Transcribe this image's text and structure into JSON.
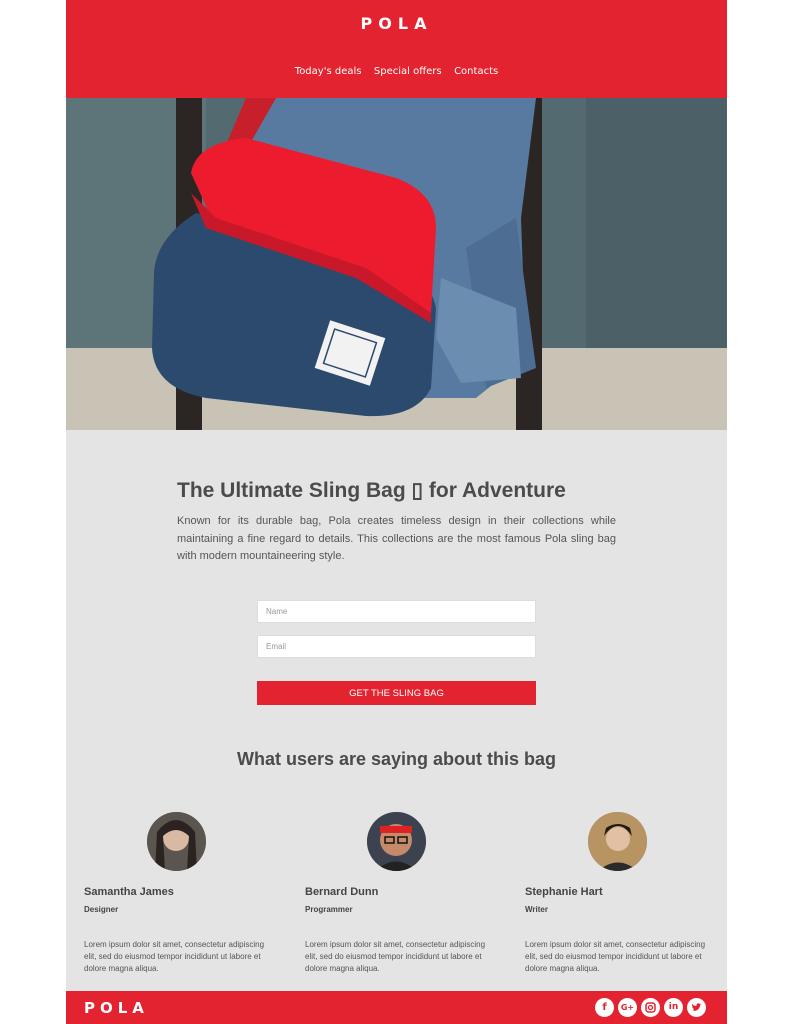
{
  "header": {
    "brand": "POLA",
    "nav": [
      "Today's deals",
      "Special offers",
      "Contacts"
    ]
  },
  "hero": {
    "image": "man-wearing-sling-bag-photo"
  },
  "intro": {
    "title": "The Ultimate Sling Bag ▯ for Adventure",
    "description": "Known for its durable bag, Pola creates timeless design in their collections while maintaining a fine regard to details. This collections are the most famous Pola sling bag with modern mountaineering style."
  },
  "form": {
    "name_placeholder": "Name",
    "email_placeholder": "Email",
    "cta_label": "GET THE SLING BAG"
  },
  "testimonials": {
    "title": "What users are saying about this bag",
    "items": [
      {
        "name": "Samantha James",
        "role": "Designer",
        "quote": "Lorem ipsum dolor sit amet, consectetur adipiscing elit, sed do eiusmod tempor incididunt ut labore et dolore magna aliqua."
      },
      {
        "name": "Bernard Dunn",
        "role": "Programmer",
        "quote": "Lorem ipsum dolor sit amet, consectetur adipiscing elit, sed do eiusmod tempor incididunt ut labore et dolore magna aliqua."
      },
      {
        "name": "Stephanie Hart",
        "role": "Writer",
        "quote": "Lorem ipsum dolor sit amet, consectetur adipiscing elit, sed do eiusmod tempor incididunt ut labore et dolore magna aliqua."
      }
    ]
  },
  "footer": {
    "brand": "POLA",
    "social": [
      "facebook-icon",
      "google-plus-icon",
      "instagram-icon",
      "linkedin-icon",
      "twitter-icon"
    ]
  },
  "colors": {
    "accent": "#e3232f",
    "background": "#e4e4e4",
    "text": "#4b4b4b"
  }
}
